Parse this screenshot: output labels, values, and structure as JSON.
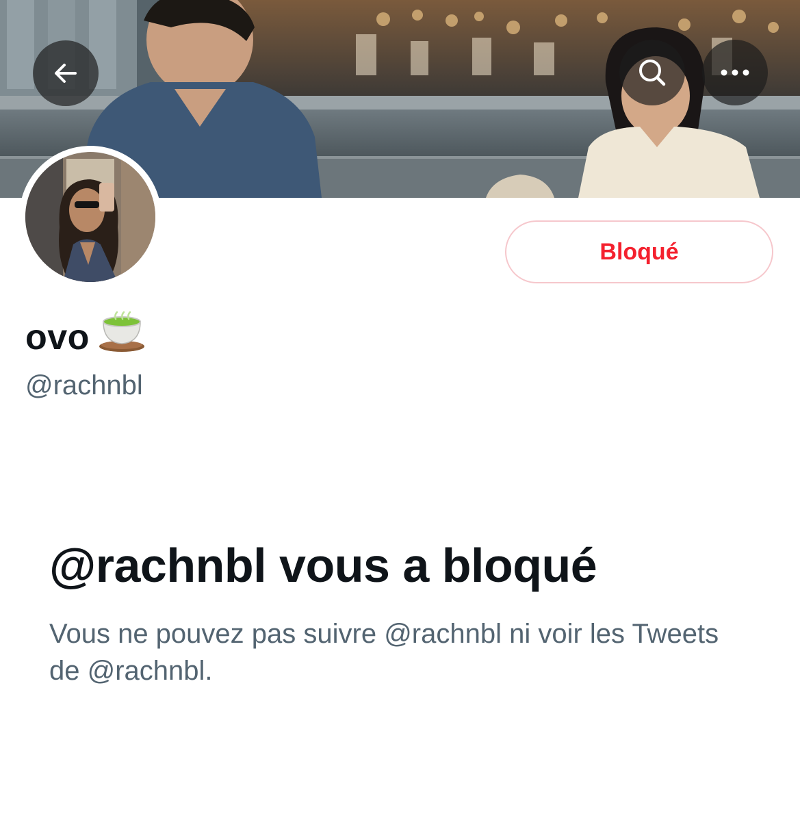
{
  "header": {
    "back_icon": "arrow-left-icon",
    "search_icon": "search-icon",
    "more_icon": "more-horizontal-icon"
  },
  "profile": {
    "display_name": "ovo",
    "name_emoji": "🍵",
    "handle": "@rachnbl",
    "blocked_button_label": "Bloqué"
  },
  "blocked_notice": {
    "title": "@rachnbl vous a bloqué",
    "description": "Vous ne pouvez pas suivre @rachnbl ni voir les Tweets de @rachnbl."
  },
  "colors": {
    "blocked_red": "#f4212e",
    "blocked_border": "#f6c7cc",
    "primary_text": "#0f1419",
    "secondary_text": "#536471"
  }
}
